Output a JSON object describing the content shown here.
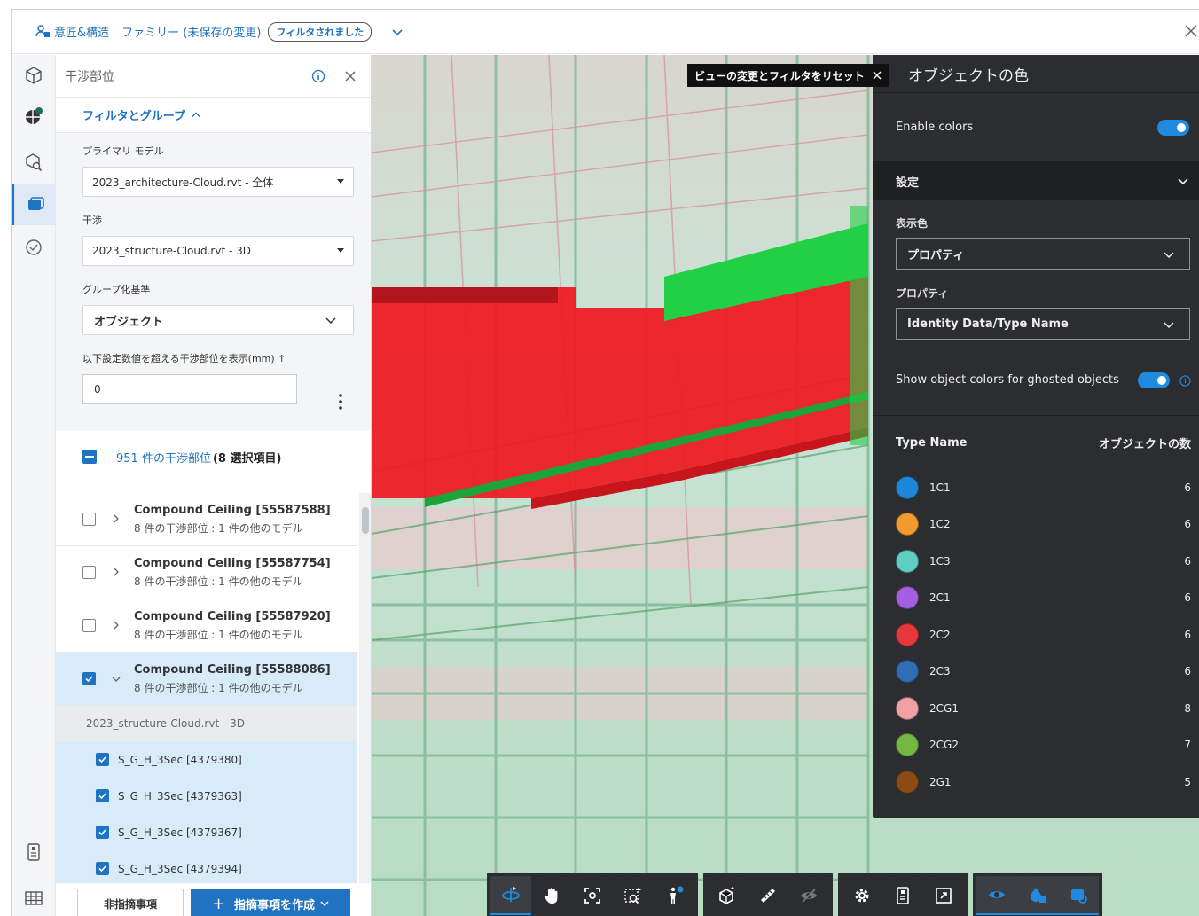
{
  "header": {
    "breadcrumb_1": "意匠&構造",
    "breadcrumb_2": "ファミリー (未保存の変更)",
    "badge": "フィルタされました"
  },
  "panel": {
    "title": "干渉部位",
    "filter_toggle": "フィルタとグループ",
    "primary_model_label": "プライマリ モデル",
    "primary_model_value": "2023_architecture-Cloud.rvt - 全体",
    "clash_label": "干渉",
    "clash_value": "2023_structure-Cloud.rvt - 3D",
    "group_label": "グループ化基準",
    "group_value": "オブジェクト",
    "threshold_label": "以下設定数値を超える干渉部位を表示(mm) ↑",
    "threshold_value": "0",
    "count_text": "951 件の干渉部位",
    "selected_text": "(8 選択項目)",
    "rows": [
      {
        "title": "Compound Ceiling [55587588]",
        "subtitle": "8 件の干渉部位 : 1 件の他のモデル"
      },
      {
        "title": "Compound Ceiling [55587754]",
        "subtitle": "8 件の干渉部位 : 1 件の他のモデル"
      },
      {
        "title": "Compound Ceiling [55587920]",
        "subtitle": "8 件の干渉部位 : 1 件の他のモデル"
      },
      {
        "title": "Compound Ceiling [55588086]",
        "subtitle": "8 件の干渉部位 : 1 件の他のモデル"
      }
    ],
    "sub_model": "2023_structure-Cloud.rvt - 3D",
    "sub_items": [
      "S_G_H_3Sec [4379380]",
      "S_G_H_3Sec [4379363]",
      "S_G_H_3Sec [4379367]",
      "S_G_H_3Sec [4379394]"
    ],
    "btn_non": "非指摘事項",
    "btn_create": "指摘事項を作成"
  },
  "viewer": {
    "reset_tip": "ビューの変更とフィルタをリセット"
  },
  "colors_panel": {
    "title": "オブジェクトの色",
    "enable_label": "Enable colors",
    "settings_label": "設定",
    "display_color_label": "表示色",
    "display_color_value": "プロパティ",
    "property_label": "プロパティ",
    "property_value": "Identity Data/Type Name",
    "ghost_label": "Show object colors for ghosted objects",
    "col_type": "Type Name",
    "col_count": "オブジェクトの数",
    "rows": [
      {
        "name": "1C1",
        "count": "6",
        "color": "#1e88d8"
      },
      {
        "name": "1C2",
        "count": "6",
        "color": "#f59a2e"
      },
      {
        "name": "1C3",
        "count": "6",
        "color": "#5fcfc4"
      },
      {
        "name": "2C1",
        "count": "6",
        "color": "#a35fe0"
      },
      {
        "name": "2C2",
        "count": "6",
        "color": "#e8373c"
      },
      {
        "name": "2C3",
        "count": "6",
        "color": "#2f6db5"
      },
      {
        "name": "2CG1",
        "count": "8",
        "color": "#f1a1a6"
      },
      {
        "name": "2CG2",
        "count": "7",
        "color": "#74b843"
      },
      {
        "name": "2G1",
        "count": "5",
        "color": "#8a4b14"
      }
    ]
  }
}
